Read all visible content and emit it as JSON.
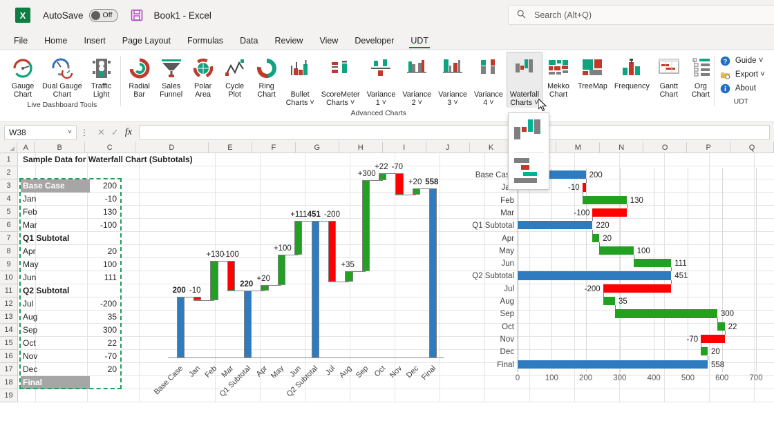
{
  "titlebar": {
    "app_logo": "excel-logo",
    "logo_letter": "X",
    "autosave_label": "AutoSave",
    "autosave_state": "Off",
    "document_title": "Book1  -  Excel",
    "search_placeholder": "Search (Alt+Q)"
  },
  "tabs": [
    {
      "label": "File",
      "active": false
    },
    {
      "label": "Home",
      "active": false
    },
    {
      "label": "Insert",
      "active": false
    },
    {
      "label": "Page Layout",
      "active": false
    },
    {
      "label": "Formulas",
      "active": false
    },
    {
      "label": "Data",
      "active": false
    },
    {
      "label": "Review",
      "active": false
    },
    {
      "label": "View",
      "active": false
    },
    {
      "label": "Developer",
      "active": false
    },
    {
      "label": "UDT",
      "active": true
    }
  ],
  "ribbon": {
    "groups": [
      {
        "label": "Live Dashboard Tools",
        "buttons": [
          {
            "label": "Gauge\nChart",
            "icon": "gauge-chart-icon",
            "dropdown": false,
            "pressed": false
          },
          {
            "label": "Dual Gauge\nChart",
            "icon": "dual-gauge-chart-icon",
            "dropdown": false,
            "pressed": false
          },
          {
            "label": "Traffic\nLight",
            "icon": "traffic-light-icon",
            "dropdown": false,
            "pressed": false
          }
        ]
      },
      {
        "label": "Advanced Charts",
        "buttons": [
          {
            "label": "Radial\nBar",
            "icon": "radial-bar-icon",
            "dropdown": false,
            "pressed": false
          },
          {
            "label": "Sales\nFunnel",
            "icon": "sales-funnel-icon",
            "dropdown": false,
            "pressed": false
          },
          {
            "label": "Polar\nArea",
            "icon": "polar-area-icon",
            "dropdown": false,
            "pressed": false
          },
          {
            "label": "Cycle\nPlot",
            "icon": "cycle-plot-icon",
            "dropdown": false,
            "pressed": false
          },
          {
            "label": "Ring\nChart",
            "icon": "ring-chart-icon",
            "dropdown": false,
            "pressed": false
          },
          {
            "label": "Bullet\nCharts",
            "icon": "bullet-charts-icon",
            "dropdown": true,
            "pressed": false
          },
          {
            "label": "ScoreMeter\nCharts",
            "icon": "scoremeter-charts-icon",
            "dropdown": true,
            "pressed": false
          },
          {
            "label": "Variance\n1",
            "icon": "variance-1-icon",
            "dropdown": true,
            "pressed": false
          },
          {
            "label": "Variance\n2",
            "icon": "variance-2-icon",
            "dropdown": true,
            "pressed": false
          },
          {
            "label": "Variance\n3",
            "icon": "variance-3-icon",
            "dropdown": true,
            "pressed": false
          },
          {
            "label": "Variance\n4",
            "icon": "variance-4-icon",
            "dropdown": true,
            "pressed": false
          },
          {
            "label": "Waterfall\nCharts",
            "icon": "waterfall-charts-icon",
            "dropdown": true,
            "pressed": true
          },
          {
            "label": "Mekko\nChart",
            "icon": "mekko-chart-icon",
            "dropdown": false,
            "pressed": false
          },
          {
            "label": "TreeMap",
            "icon": "treemap-icon",
            "dropdown": false,
            "pressed": false
          },
          {
            "label": "Frequency",
            "icon": "frequency-icon",
            "dropdown": false,
            "pressed": false
          },
          {
            "label": "Gantt\nChart",
            "icon": "gantt-chart-icon",
            "dropdown": false,
            "pressed": false
          },
          {
            "label": "Org\nChart",
            "icon": "org-chart-icon",
            "dropdown": false,
            "pressed": false
          }
        ]
      }
    ],
    "udt_group": {
      "label": "UDT",
      "items": [
        {
          "label": "Guide",
          "icon": "help-circle-icon",
          "dropdown": true
        },
        {
          "label": "Export",
          "icon": "export-folder-icon",
          "dropdown": true
        },
        {
          "label": "About",
          "icon": "info-circle-icon",
          "dropdown": false
        }
      ]
    },
    "dropdown_gallery": {
      "open": true,
      "items": [
        {
          "name": "vertical-waterfall-thumbnail"
        },
        {
          "name": "horizontal-waterfall-thumbnail"
        }
      ]
    }
  },
  "formula_bar": {
    "name_box_value": "W38",
    "formula_value": "",
    "cancel_icon": "close-icon",
    "enter_icon": "check-icon",
    "function_icon": "fx-icon"
  },
  "grid": {
    "columns": [
      "A",
      "B",
      "C",
      "D",
      "E",
      "F",
      "G",
      "H",
      "I",
      "J",
      "K",
      "L",
      "M",
      "N",
      "O",
      "P",
      "Q"
    ],
    "rows": [
      1,
      2,
      3,
      4,
      5,
      6,
      7,
      8,
      9,
      10,
      11,
      12,
      13,
      14,
      15,
      16,
      17,
      18,
      19
    ],
    "title_cell": "Sample Data for Waterfall Chart (Subtotals)",
    "data_rows": [
      {
        "row": 3,
        "label": "Base Case",
        "value": "200",
        "style": "shade"
      },
      {
        "row": 4,
        "label": "Jan",
        "value": "-10",
        "style": "plain"
      },
      {
        "row": 5,
        "label": "Feb",
        "value": "130",
        "style": "plain"
      },
      {
        "row": 6,
        "label": "Mar",
        "value": "-100",
        "style": "plain"
      },
      {
        "row": 7,
        "label": "Q1 Subtotal",
        "value": "",
        "style": "bold"
      },
      {
        "row": 8,
        "label": "Apr",
        "value": "20",
        "style": "plain"
      },
      {
        "row": 9,
        "label": "May",
        "value": "100",
        "style": "plain"
      },
      {
        "row": 10,
        "label": "Jun",
        "value": "111",
        "style": "plain"
      },
      {
        "row": 11,
        "label": "Q2 Subtotal",
        "value": "",
        "style": "bold"
      },
      {
        "row": 12,
        "label": "Jul",
        "value": "-200",
        "style": "plain"
      },
      {
        "row": 13,
        "label": "Aug",
        "value": "35",
        "style": "plain"
      },
      {
        "row": 14,
        "label": "Sep",
        "value": "300",
        "style": "plain"
      },
      {
        "row": 15,
        "label": "Oct",
        "value": "22",
        "style": "plain"
      },
      {
        "row": 16,
        "label": "Nov",
        "value": "-70",
        "style": "plain"
      },
      {
        "row": 17,
        "label": "Dec",
        "value": "20",
        "style": "plain"
      },
      {
        "row": 18,
        "label": "Final",
        "value": "",
        "style": "shade"
      }
    ],
    "selection_marquee": "B3:C18"
  },
  "colors": {
    "total_blue": "#2e7cbf",
    "increase_green": "#22a022",
    "decrease_red": "#ff0000",
    "connector_gray": "#808080",
    "accent_green": "#107c41",
    "teal": "#0fa37f",
    "brick": "#c0392b",
    "slate": "#7f7f7f"
  },
  "chart_data": [
    {
      "type": "bar",
      "subtype": "waterfall-vertical",
      "title": "",
      "categories": [
        "Base Case",
        "Jan",
        "Feb",
        "Mar",
        "Q1 Subtotal",
        "Apr",
        "May",
        "Jun",
        "Q2 Subtotal",
        "Jul",
        "Aug",
        "Sep",
        "Oct",
        "Nov",
        "Dec",
        "Final"
      ],
      "values": [
        200,
        -10,
        130,
        -100,
        220,
        20,
        100,
        111,
        451,
        -200,
        35,
        300,
        22,
        -70,
        20,
        558
      ],
      "kinds": [
        "total",
        "delta",
        "delta",
        "delta",
        "total",
        "delta",
        "delta",
        "delta",
        "total",
        "delta",
        "delta",
        "delta",
        "delta",
        "delta",
        "delta",
        "total"
      ],
      "data_labels": [
        "200",
        "-10",
        "+130",
        "-100",
        "220",
        "+20",
        "+100",
        "+111",
        "451",
        "-200",
        "+35",
        "+300",
        "+22",
        "-70",
        "+20",
        "558"
      ],
      "cumulative_start": [
        0,
        200,
        190,
        320,
        0,
        220,
        240,
        340,
        0,
        451,
        251,
        286,
        586,
        608,
        538,
        0
      ],
      "cumulative_end": [
        200,
        190,
        320,
        220,
        220,
        240,
        340,
        451,
        451,
        251,
        286,
        586,
        608,
        538,
        558,
        558
      ],
      "ylim": [
        0,
        620
      ],
      "xlabel": "",
      "ylabel": "",
      "grid": false,
      "legend": "none",
      "axis_labels_rotated": true
    },
    {
      "type": "bar",
      "subtype": "waterfall-horizontal",
      "title": "",
      "categories": [
        "Base Case",
        "Jan",
        "Feb",
        "Mar",
        "Q1 Subtotal",
        "Apr",
        "May",
        "Jun",
        "Q2 Subtotal",
        "Jul",
        "Aug",
        "Sep",
        "Oct",
        "Nov",
        "Dec",
        "Final"
      ],
      "values": [
        200,
        -10,
        130,
        -100,
        220,
        20,
        100,
        111,
        451,
        -200,
        35,
        300,
        22,
        -70,
        20,
        558
      ],
      "kinds": [
        "total",
        "delta",
        "delta",
        "delta",
        "total",
        "delta",
        "delta",
        "delta",
        "total",
        "delta",
        "delta",
        "delta",
        "delta",
        "delta",
        "delta",
        "total"
      ],
      "data_labels": [
        "200",
        "-10",
        "130",
        "-100",
        "220",
        "20",
        "100",
        "111",
        "451",
        "-200",
        "35",
        "300",
        "22",
        "-70",
        "20",
        "558"
      ],
      "cumulative_start": [
        0,
        200,
        190,
        320,
        0,
        220,
        240,
        340,
        0,
        451,
        251,
        286,
        586,
        608,
        538,
        0
      ],
      "cumulative_end": [
        200,
        190,
        320,
        220,
        220,
        240,
        340,
        451,
        451,
        251,
        286,
        586,
        608,
        538,
        558,
        558
      ],
      "xticks": [
        0,
        100,
        200,
        300,
        400,
        500,
        600,
        700
      ],
      "xlim": [
        0,
        700
      ],
      "xlabel": "",
      "ylabel": "",
      "grid": true,
      "legend": "none"
    }
  ]
}
